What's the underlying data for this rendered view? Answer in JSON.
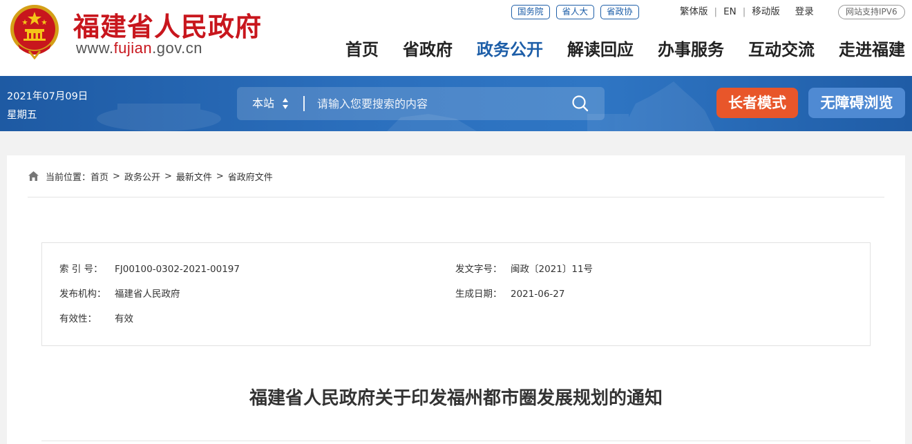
{
  "header": {
    "site_title": "福建省人民政府",
    "site_url_prefix": "www.",
    "site_url_highlight": "fujian",
    "site_url_suffix": ".gov.cn",
    "top_pills": [
      "国务院",
      "省人大",
      "省政协"
    ],
    "top_links": {
      "traditional": "繁体版",
      "english": "EN",
      "mobile": "移动版",
      "login": "登录",
      "separator": "|"
    },
    "ipv6_badge": "网站支持IPV6",
    "nav": [
      {
        "label": "首页",
        "active": false
      },
      {
        "label": "省政府",
        "active": false
      },
      {
        "label": "政务公开",
        "active": true
      },
      {
        "label": "解读回应",
        "active": false
      },
      {
        "label": "办事服务",
        "active": false
      },
      {
        "label": "互动交流",
        "active": false
      },
      {
        "label": "走进福建",
        "active": false
      }
    ]
  },
  "banner": {
    "date": "2021年07月09日",
    "weekday": "星期五",
    "search_scope": "本站",
    "search_placeholder": "请输入您要搜索的内容",
    "elder_mode": "长者模式",
    "accessibility": "无障碍浏览"
  },
  "breadcrumb": {
    "prefix": "当前位置：",
    "items": [
      "首页",
      "政务公开",
      "最新文件",
      "省政府文件"
    ],
    "separator": ">"
  },
  "meta": {
    "index_label": "索 引 号：",
    "index_value": "FJ00100-0302-2021-00197",
    "doc_no_label": "发文字号：",
    "doc_no_value": "闽政〔2021〕11号",
    "issuer_label": "发布机构：",
    "issuer_value": "福建省人民政府",
    "date_label": "生成日期：",
    "date_value": "2021-06-27",
    "validity_label": "有效性：",
    "validity_value": "有效"
  },
  "document": {
    "title": "福建省人民政府关于印发福州都市圈发展规划的通知"
  },
  "colors": {
    "brand_red": "#c8161d",
    "brand_blue": "#1d5ea8",
    "banner_blue": "#2b6fbd",
    "elder_orange": "#e8562a",
    "access_blue": "#4f8ad3"
  }
}
